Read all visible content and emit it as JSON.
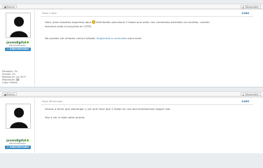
{
  "toolbar": {
    "delete_label": "Borrar",
    "reply_label": "Responder"
  },
  "posts": [
    {
      "header": "Hace 1 hora",
      "number": "#284",
      "username": "jovendigital",
      "role": "Administrador",
      "badge": "Administrador",
      "stats": {
        "messages": "Mensajes: 7rs",
        "thanks": "Gracias: 7rs",
        "joined": "Registro en: jun 2017",
        "reputation_label": "Reputación:",
        "reputation_value": "12",
        "location": "Lugar: Madrid"
      },
      "text_1a": "Hola, para nosotros seguimos aqui",
      "text_1b": "Intentando solucionar 2 todos que salen con caracteres extraños sin sentido, cuando tenemos todo el proyecto en UTF8.",
      "text_2a": "No puedes ver enlaces como invitado.",
      "text_2b": "Registrate",
      "text_2c": "o",
      "text_2d": "conectate",
      "text_2e": "para verlo."
    },
    {
      "header": "Hace 28 minutos",
      "number": "#285",
      "username": "jovendigital",
      "role": "Administrador",
      "badge": "Administrador",
      "text_1": "Vamos a tener que descargar y ver que hace que 2 todos en una documentacione salgan mal.",
      "text_2": "Voy a ver si todo sales pronto."
    }
  ]
}
